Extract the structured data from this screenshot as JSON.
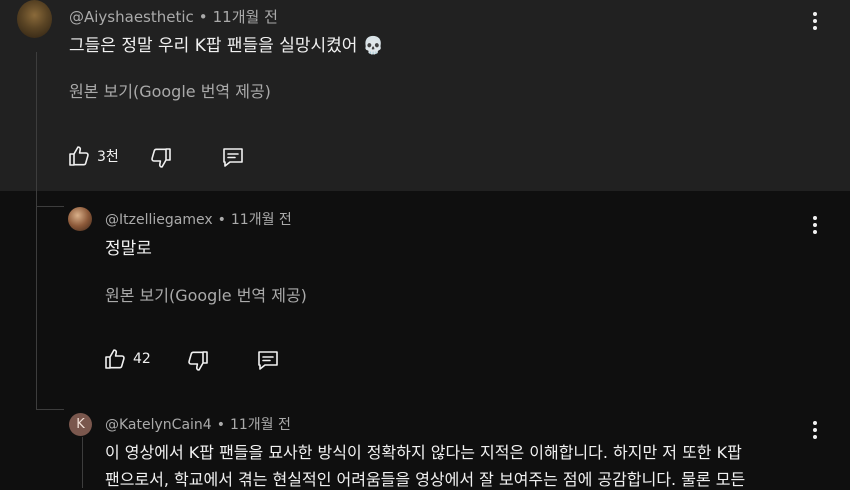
{
  "comment": {
    "author": "@Aiyshaesthetic",
    "time": "11개월 전",
    "text": "그들은 정말 우리 K팝 팬들을 실망시켰어",
    "emoji": "💀",
    "translate_link": "원본 보기(Google 번역 제공)",
    "likes": "3천"
  },
  "replies": [
    {
      "author": "@Itzelliegamex",
      "time": "11개월 전",
      "text": "정말로",
      "translate_link": "원본 보기(Google 번역 제공)",
      "likes": "42"
    },
    {
      "author": "@KatelynCain4",
      "avatar_letter": "K",
      "time": "11개월 전",
      "text_line1": "이 영상에서 K팝 팬들을 묘사한 방식이 정확하지 않다는 지적은 이해합니다. 하지만 저 또한 K팝",
      "text_line2": "팬으로서, 학교에서 겪는 현실적인 어려움들을 영상에서 잘 보여주는 점에 공감합니다. 물론 모든"
    }
  ],
  "icons": {
    "like": "thumbs-up-icon",
    "dislike": "thumbs-down-icon",
    "reply": "reply-icon",
    "more": "more-vert-icon"
  },
  "colors": {
    "background": "#0f0f0f",
    "highlight": "#212121",
    "secondary_text": "#aaaaaa",
    "thread_line": "#3d3d3d"
  }
}
